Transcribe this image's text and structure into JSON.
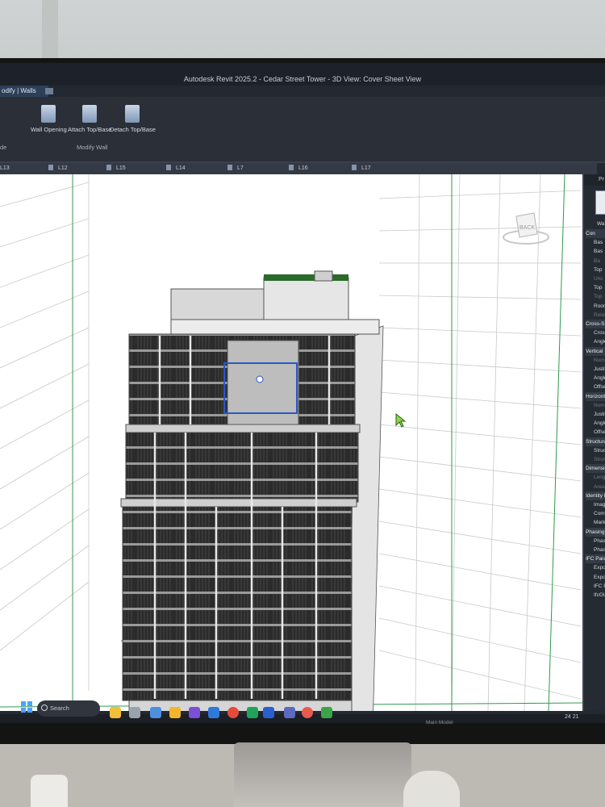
{
  "app": {
    "title": "Autodesk Revit 2025.2 - Cedar Street Tower - 3D View: Cover Sheet View",
    "context_tab": "odify | Walls"
  },
  "ribbon": {
    "buttons": [
      {
        "label": "Wall Opening",
        "icon": "wall-opening-icon"
      },
      {
        "label": "Attach Top/Base",
        "icon": "attach-top-base-icon"
      },
      {
        "label": "Detach Top/Base",
        "icon": "detach-top-base-icon"
      }
    ],
    "group_label": "Modify Wall",
    "left_group_label": "de"
  },
  "view_tabs": [
    "L13",
    "L12",
    "L15",
    "L14",
    "L7",
    "L16",
    "L17"
  ],
  "viewcube": {
    "label": "BACK"
  },
  "properties": {
    "header": "Pr",
    "type_label": "Wa",
    "rows": [
      {
        "text": "Con",
        "style": "hdr"
      },
      {
        "text": "Bas",
        "style": ""
      },
      {
        "text": "Bas",
        "style": ""
      },
      {
        "text": "Ba",
        "style": "dim"
      },
      {
        "text": "Top",
        "style": ""
      },
      {
        "text": "Unc",
        "style": "dim"
      },
      {
        "text": "Top",
        "style": ""
      },
      {
        "text": "Top",
        "style": "dim"
      },
      {
        "text": "Room",
        "style": ""
      },
      {
        "text": "Relat",
        "style": "dim"
      },
      {
        "text": "Cross-S",
        "style": "hdr"
      },
      {
        "text": "Cross-",
        "style": ""
      },
      {
        "text": "Angle",
        "style": ""
      },
      {
        "text": "Vertical",
        "style": "hdr"
      },
      {
        "text": "Numbe",
        "style": "dim"
      },
      {
        "text": "Justifica",
        "style": ""
      },
      {
        "text": "Angle",
        "style": ""
      },
      {
        "text": "Offset",
        "style": ""
      },
      {
        "text": "Horizontal",
        "style": "hdr"
      },
      {
        "text": "Number",
        "style": "dim"
      },
      {
        "text": "Justificat",
        "style": ""
      },
      {
        "text": "Angle",
        "style": ""
      },
      {
        "text": "Offset",
        "style": ""
      },
      {
        "text": "Structural",
        "style": "hdr"
      },
      {
        "text": "Structural",
        "style": ""
      },
      {
        "text": "Structural",
        "style": "dim"
      },
      {
        "text": "Dimensions",
        "style": "hdr"
      },
      {
        "text": "Length",
        "style": "dim"
      },
      {
        "text": "Area",
        "style": "dim"
      },
      {
        "text": "Identity Data",
        "style": "hdr"
      },
      {
        "text": "Image",
        "style": ""
      },
      {
        "text": "Comments",
        "style": ""
      },
      {
        "text": "Mark",
        "style": ""
      },
      {
        "text": "Phasing",
        "style": "hdr"
      },
      {
        "text": "Phase Create",
        "style": ""
      },
      {
        "text": "Phase Demol",
        "style": ""
      },
      {
        "text": "IFC Parameters",
        "style": "hdr"
      },
      {
        "text": "Export to IFC",
        "style": ""
      },
      {
        "text": "Export to IFC A",
        "style": ""
      },
      {
        "text": "IFC Predefined",
        "style": ""
      },
      {
        "text": "IfcGUID",
        "style": ""
      }
    ]
  },
  "taskbar": {
    "search_placeholder": "Search",
    "apps": [
      "file-explorer-icon",
      "browser-icon",
      "vscode-icon",
      "chrome-icon",
      "sheets-icon",
      "revit-icon",
      "teams-icon"
    ],
    "status_model": "Main Model",
    "scale_value": "24 21"
  }
}
